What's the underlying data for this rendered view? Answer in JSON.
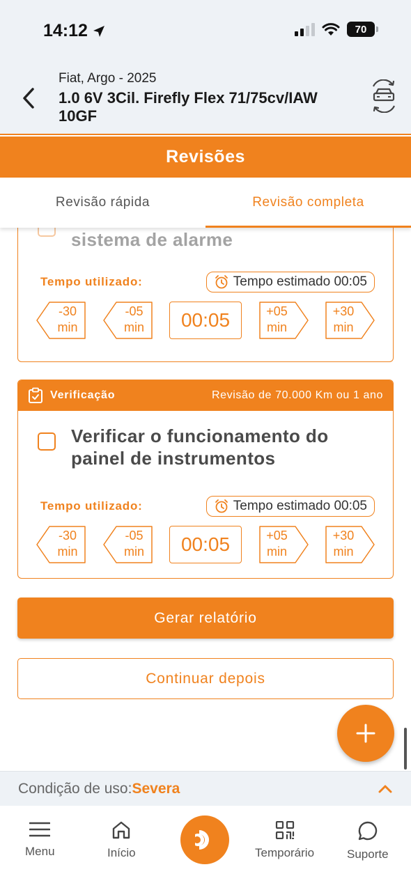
{
  "status_bar": {
    "time": "14:12",
    "battery": "70"
  },
  "vehicle": {
    "subtitle": "Fiat, Argo - 2025",
    "title": "1.0 6V 3Cil. Firefly Flex 71/75cv/IAW 10GF"
  },
  "section_title": "Revisões",
  "tabs": [
    {
      "label": "Revisão rápida",
      "active": false
    },
    {
      "label": "Revisão completa",
      "active": true
    }
  ],
  "cards": [
    {
      "task": "sistema de alarme",
      "time_label": "Tempo utilizado:",
      "estimate": "Tempo estimado 00:05",
      "time_value": "00:05",
      "steps": [
        {
          "top": "-30",
          "bottom": "min"
        },
        {
          "top": "-05",
          "bottom": "min"
        },
        {
          "top": "+05",
          "bottom": "min"
        },
        {
          "top": "+30",
          "bottom": "min"
        }
      ]
    },
    {
      "category": "Verificação",
      "revision": "Revisão de 70.000 Km ou 1 ano",
      "task": "Verificar o funcionamento do painel de instrumentos",
      "time_label": "Tempo utilizado:",
      "estimate": "Tempo estimado 00:05",
      "time_value": "00:05",
      "steps": [
        {
          "top": "-30",
          "bottom": "min"
        },
        {
          "top": "-05",
          "bottom": "min"
        },
        {
          "top": "+05",
          "bottom": "min"
        },
        {
          "top": "+30",
          "bottom": "min"
        }
      ]
    }
  ],
  "buttons": {
    "generate_report": "Gerar relatório",
    "continue_later": "Continuar depois"
  },
  "usage": {
    "label": "Condição de uso:",
    "value": "Severa"
  },
  "nav": [
    {
      "label": "Menu",
      "icon": "menu-icon"
    },
    {
      "label": "Início",
      "icon": "home-icon"
    },
    {
      "label": "",
      "icon": "brand-logo-icon"
    },
    {
      "label": "Temporário",
      "icon": "qr-code-icon"
    },
    {
      "label": "Suporte",
      "icon": "chat-icon"
    }
  ],
  "colors": {
    "accent": "#f0821e",
    "header_bg": "#eef2f6"
  }
}
